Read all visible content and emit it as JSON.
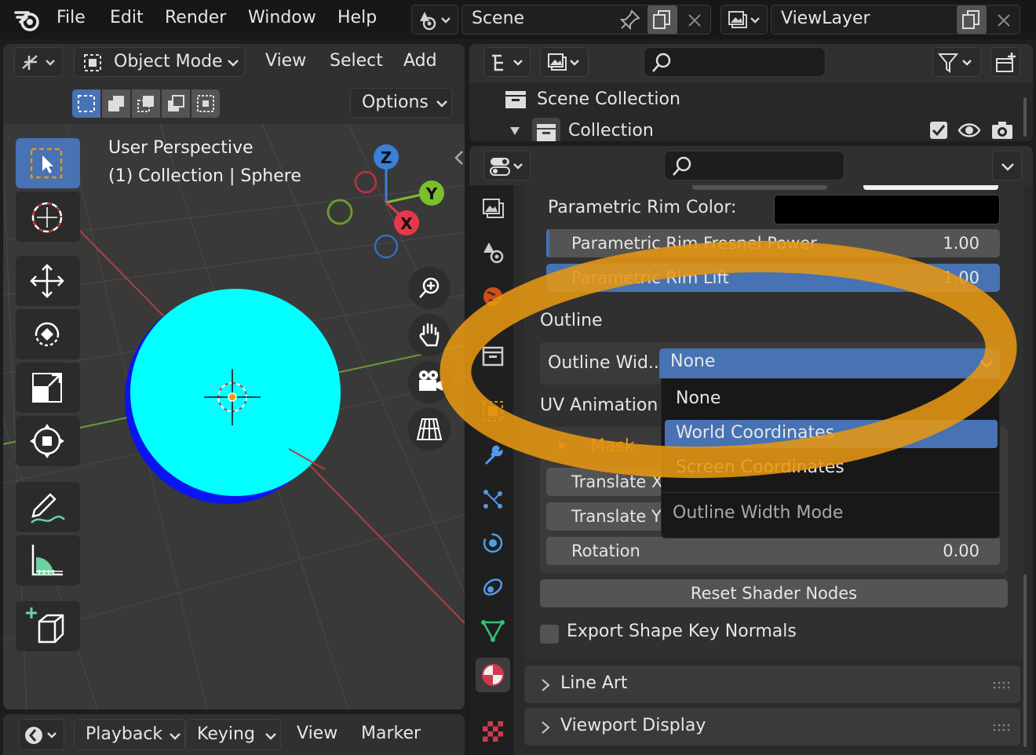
{
  "menu": {
    "items": [
      "File",
      "Edit",
      "Render",
      "Window",
      "Help"
    ],
    "scene_label": "Scene",
    "viewlayer_label": "ViewLayer"
  },
  "viewport": {
    "mode_label": "Object Mode",
    "header_menus": [
      "View",
      "Select",
      "Add"
    ],
    "options_label": "Options",
    "perspective_label": "User Perspective",
    "collection_label": "(1) Collection | Sphere",
    "gizmo_axes": {
      "z": "Z",
      "y": "Y",
      "x": "X"
    }
  },
  "timeline": {
    "menus": [
      "Playback",
      "Keying",
      "View",
      "Marker"
    ]
  },
  "outliner": {
    "scene_collection": "Scene Collection",
    "collection": "Collection"
  },
  "properties": {
    "rim_color_label": "Parametric Rim Color:",
    "rim_fresnel": {
      "label": "Parametric Rim Fresnel Power",
      "value": "1.00"
    },
    "rim_lift": {
      "label": "Parametric Rim Lift",
      "value": "1.00"
    },
    "outline_section": "Outline",
    "outline_width_label": "Outline Wid...",
    "outline_width_value": "None",
    "uv_animation_label": "UV Animation",
    "mask_label": "Mask",
    "translate_x_label": "Translate X",
    "translate_y_label": "Translate Y",
    "rotation": {
      "label": "Rotation",
      "value": "0.00"
    },
    "reset_button": "Reset Shader Nodes",
    "export_checkbox": "Export Shape Key Normals",
    "line_art": "Line Art",
    "viewport_display": "Viewport Display"
  },
  "dropdown": {
    "items": [
      "None",
      "World Coordinates",
      "Screen Coordinates"
    ],
    "selected_index": 1,
    "title": "Outline Width Mode"
  },
  "colors": {
    "accent": "#4772b3",
    "highlight_ring": "#e69612",
    "sphere": "#00ffff",
    "sphere_shadow": "#0a14ee"
  }
}
